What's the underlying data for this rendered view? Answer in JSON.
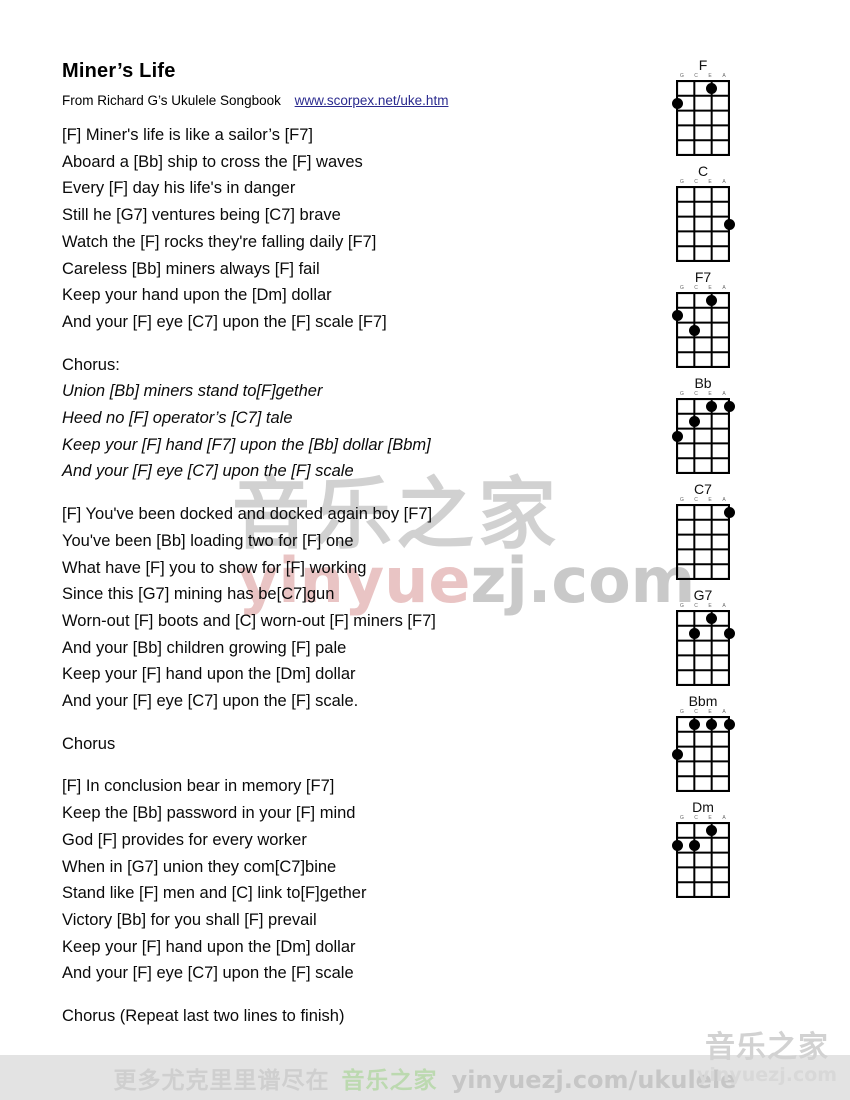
{
  "header": {
    "title": "Miner’s Life",
    "credit": "From Richard G’s Ukulele Songbook",
    "link": "www.scorpex.net/uke.htm"
  },
  "verses": [
    {
      "name": "verse-1",
      "italic": false,
      "lines": [
        "[F] Miner's life is like a sailor’s [F7]",
        "Aboard a [Bb] ship to cross the [F] waves",
        "Every [F] day his life's in danger",
        "Still he [G7] ventures being [C7] brave",
        "Watch the [F] rocks they're falling daily [F7]",
        "Careless [Bb] miners always [F] fail",
        "Keep your hand upon the [Dm] dollar",
        "And your [F] eye [C7] upon the [F] scale [F7]"
      ]
    },
    {
      "name": "chorus-1",
      "italic": true,
      "label": "Chorus:",
      "lines": [
        "Union [Bb] miners stand to[F]gether",
        "Heed no [F] operator’s [C7] tale",
        "Keep your [F] hand [F7] upon the [Bb] dollar [Bbm]",
        "And your [F] eye [C7] upon the [F] scale"
      ]
    },
    {
      "name": "verse-2",
      "italic": false,
      "lines": [
        "[F] You've been docked and docked again boy [F7]",
        "You've been [Bb] loading two for [F] one",
        "What have [F] you to show for [F] working",
        "Since this [G7] mining has be[C7]gun",
        "Worn-out [F] boots and [C] worn-out [F] miners [F7]",
        "And your [Bb] children growing [F] pale",
        "Keep your [F] hand upon the [Dm] dollar",
        "And your [F] eye [C7] upon the [F] scale."
      ]
    },
    {
      "name": "chorus-2",
      "italic": false,
      "label": "Chorus",
      "lines": []
    },
    {
      "name": "verse-3",
      "italic": false,
      "lines": [
        "[F] In conclusion bear in memory [F7]",
        "Keep the [Bb] password in your [F] mind",
        "God [F] provides for every worker",
        "When in [G7] union they com[C7]bine",
        "Stand like [F] men and [C] link to[F]gether",
        "Victory [Bb] for you shall [F] prevail",
        "Keep your [F] hand upon the [Dm] dollar",
        "And your [F] eye [C7] upon the [F] scale"
      ]
    },
    {
      "name": "chorus-3",
      "italic": false,
      "label": "Chorus  (Repeat last two lines to finish)",
      "lines": []
    }
  ],
  "chords": {
    "string_labels": [
      "G",
      "C",
      "E",
      "A"
    ],
    "frets": 5,
    "diagrams": [
      {
        "name": "F",
        "dots": [
          {
            "string": 3,
            "fret": 1
          },
          {
            "string": 1,
            "fret": 2
          }
        ]
      },
      {
        "name": "C",
        "dots": [
          {
            "string": 4,
            "fret": 3
          }
        ]
      },
      {
        "name": "F7",
        "dots": [
          {
            "string": 3,
            "fret": 1
          },
          {
            "string": 1,
            "fret": 2
          },
          {
            "string": 2,
            "fret": 3
          }
        ]
      },
      {
        "name": "Bb",
        "dots": [
          {
            "string": 3,
            "fret": 1
          },
          {
            "string": 4,
            "fret": 1
          },
          {
            "string": 2,
            "fret": 2
          },
          {
            "string": 1,
            "fret": 3
          }
        ]
      },
      {
        "name": "C7",
        "dots": [
          {
            "string": 4,
            "fret": 1
          }
        ]
      },
      {
        "name": "G7",
        "dots": [
          {
            "string": 3,
            "fret": 1
          },
          {
            "string": 2,
            "fret": 2
          },
          {
            "string": 4,
            "fret": 2
          }
        ]
      },
      {
        "name": "Bbm",
        "dots": [
          {
            "string": 2,
            "fret": 1
          },
          {
            "string": 3,
            "fret": 1
          },
          {
            "string": 4,
            "fret": 1
          },
          {
            "string": 1,
            "fret": 3
          }
        ]
      },
      {
        "name": "Dm",
        "dots": [
          {
            "string": 3,
            "fret": 1
          },
          {
            "string": 1,
            "fret": 2
          },
          {
            "string": 2,
            "fret": 2
          }
        ]
      }
    ]
  },
  "watermarks": {
    "center_cn": "音乐之家",
    "center_domain_pink": "yinyue",
    "center_domain_grey": "zj.com",
    "corner_cn": "音乐之家",
    "corner_domain": "yinyuezj.com"
  },
  "footer": {
    "cn_text": "更多尤克里里谱尽在",
    "brand": "音乐之家",
    "url": "yinyuezj.com/ukulele"
  }
}
